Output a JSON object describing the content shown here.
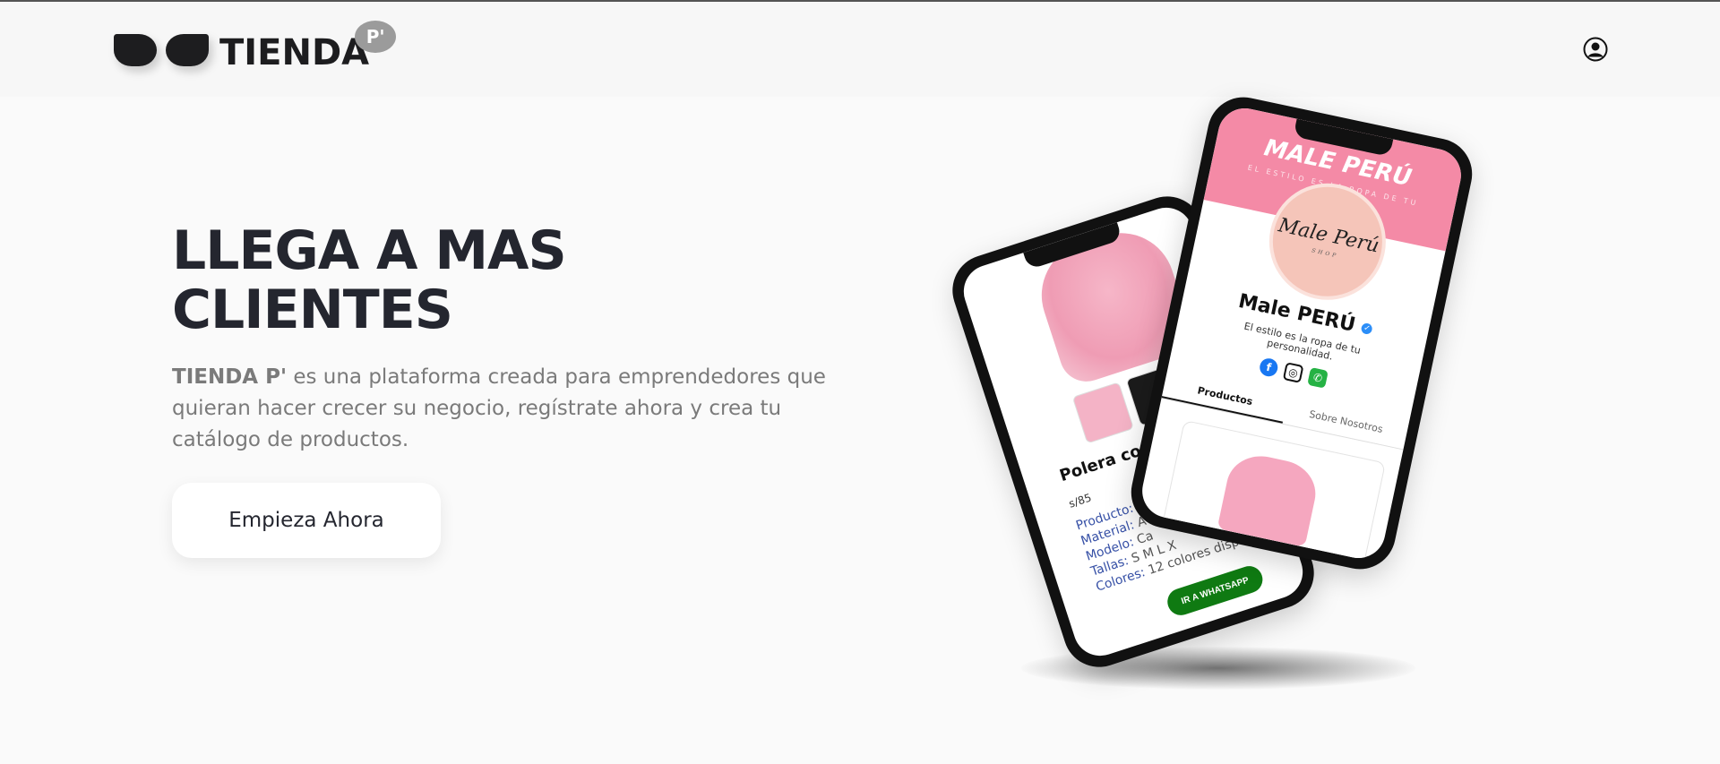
{
  "header": {
    "logo_word": "TIENDA",
    "logo_badge": "P'"
  },
  "hero": {
    "title": "LLEGA A MAS CLIENTES",
    "desc_brand": "TIENDA P'",
    "desc_rest": " es una plataforma creada para emprendedores que quieran hacer crecer su negocio, regístrate ahora y crea tu catálogo de productos.",
    "cta_label": "Empieza Ahora"
  },
  "mockup_back": {
    "product_title": "Polera con b",
    "price": "s/85",
    "details": [
      {
        "key": "Producto:",
        "value": " canguro"
      },
      {
        "key": "Material:",
        "value": " A"
      },
      {
        "key": "Modelo:",
        "value": " Ca"
      },
      {
        "key": "Tallas:",
        "value": " S M L X"
      },
      {
        "key": "Colores:",
        "value": " 12 colores disponibles"
      }
    ],
    "whatsapp_label": "IR A WHATSAPP"
  },
  "mockup_front": {
    "banner_title": "MALE PERÚ",
    "banner_sub": "EL ESTILO ES LA ROPA DE TU",
    "avatar_text": "Male Perú",
    "avatar_sub": "SHOP",
    "store_name": "Male PERÚ",
    "verified_mark": "✓",
    "store_tagline": "El estilo es la ropa de tu personalidad.",
    "tabs": [
      "Productos",
      "Sobre Nosotros"
    ]
  },
  "icons": {
    "user": "user-circle-icon",
    "facebook": "facebook-icon",
    "instagram": "instagram-icon",
    "whatsapp": "whatsapp-icon"
  },
  "colors": {
    "background": "#fafafa",
    "title": "#24262f",
    "body_text": "#7a7a7a",
    "banner_pink": "#f48aa6",
    "whatsapp_green": "#0f7a12"
  }
}
